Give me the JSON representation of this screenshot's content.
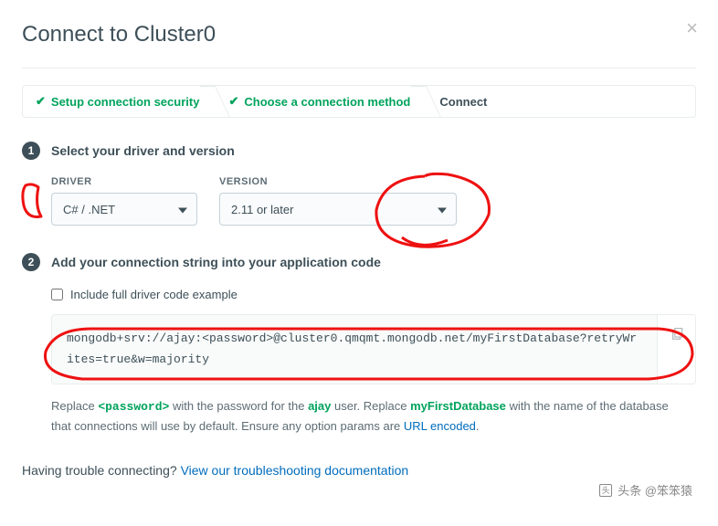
{
  "header": {
    "title": "Connect to Cluster0"
  },
  "breadcrumb": {
    "step1": "Setup connection security",
    "step2": "Choose a connection method",
    "step3": "Connect"
  },
  "step1": {
    "num": "1",
    "title": "Select your driver and version",
    "driver_label": "DRIVER",
    "driver_value": "C# / .NET",
    "version_label": "VERSION",
    "version_value": "2.11 or later"
  },
  "step2": {
    "num": "2",
    "title": "Add your connection string into your application code",
    "checkbox_label": "Include full driver code example",
    "connection_string": "mongodb+srv://ajay:<password>@cluster0.qmqmt.mongodb.net/myFirstDatabase?retryWrites=true&w=majority",
    "helper_prefix": "Replace ",
    "helper_pw": "<password>",
    "helper_mid1": " with the password for the ",
    "helper_user": "ajay",
    "helper_mid2": " user. Replace ",
    "helper_db": "myFirstDatabase",
    "helper_mid3": " with the name of the database that connections will use by default. Ensure any option params are ",
    "helper_link": "URL encoded",
    "helper_end": "."
  },
  "trouble": {
    "prefix": "Having trouble connecting? ",
    "link": "View our troubleshooting documentation"
  },
  "watermark": {
    "text": "头条 @笨笨猿"
  }
}
